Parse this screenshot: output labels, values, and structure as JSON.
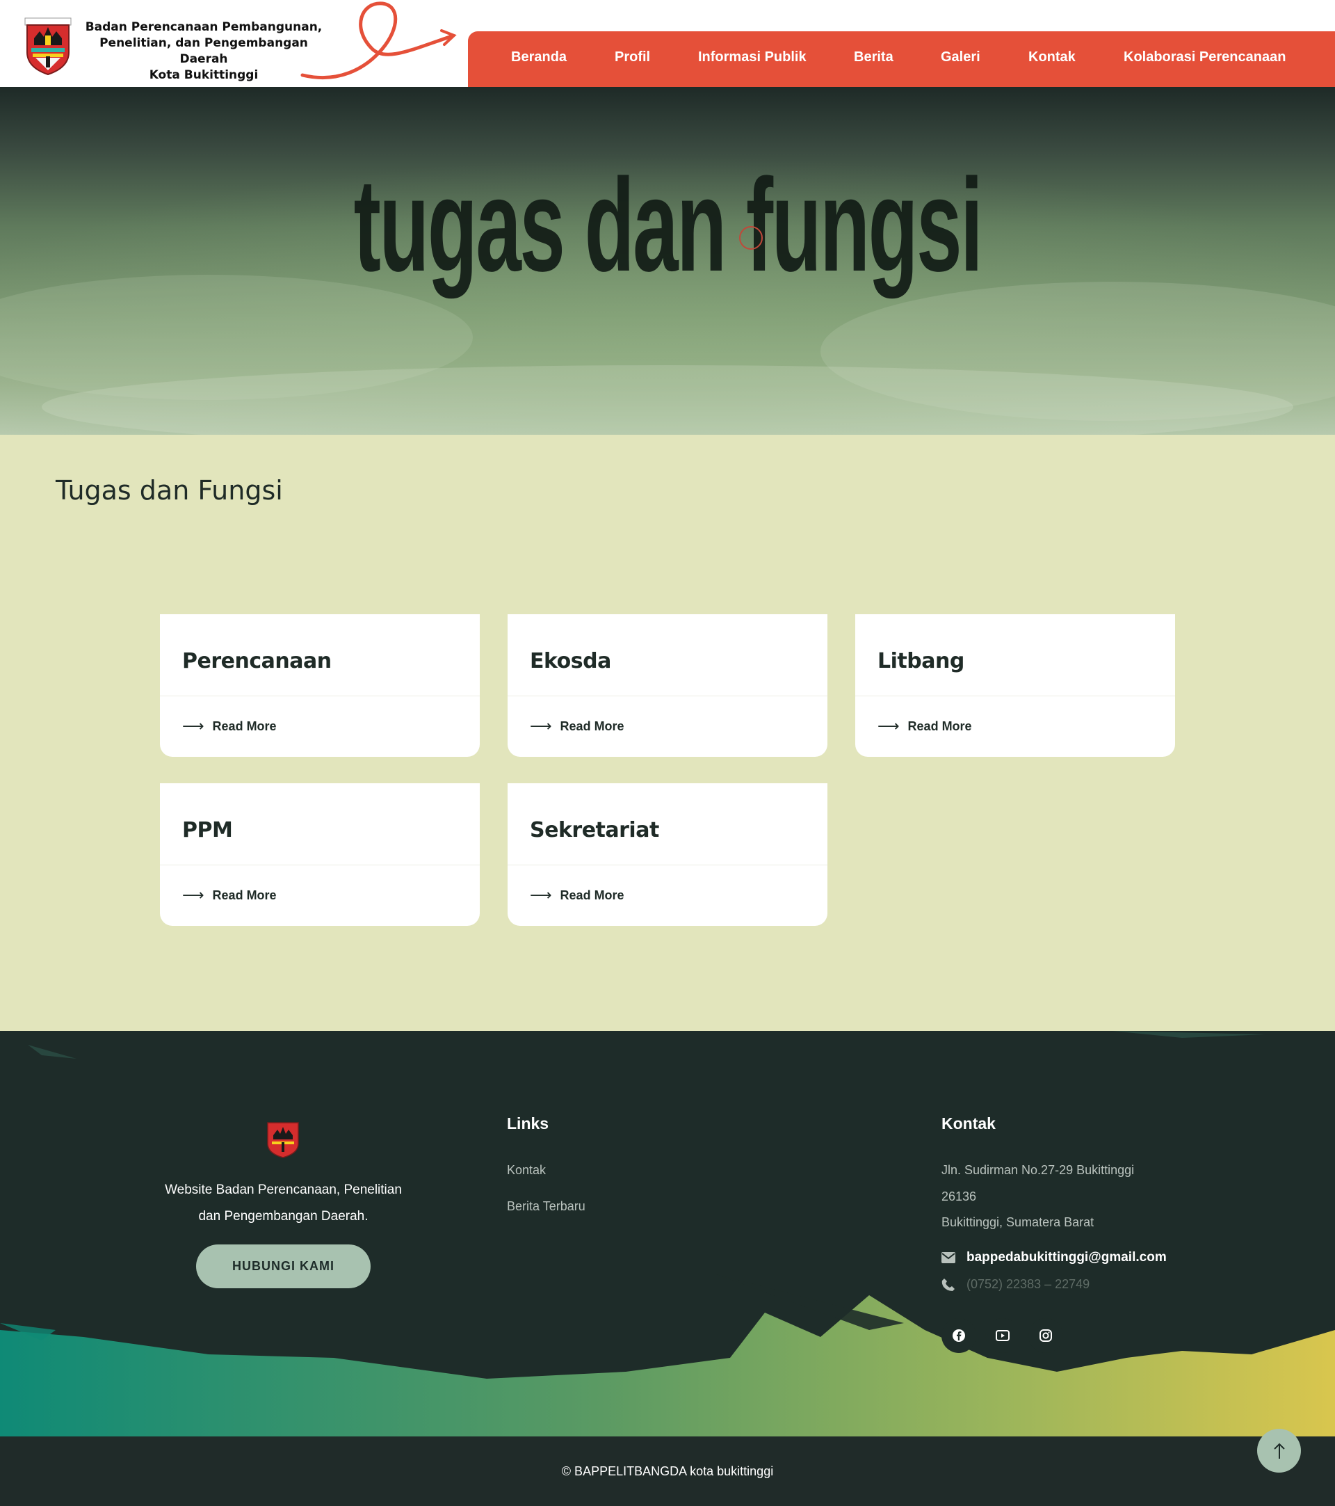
{
  "header": {
    "org_name_line1": "Badan Perencanaan Pembangunan,",
    "org_name_line2": "Penelitian, dan Pengembangan Daerah",
    "org_name_line3": "Kota Bukittinggi",
    "logo_label": "BUKITTINGGI",
    "nav": [
      "Beranda",
      "Profil",
      "Informasi Publik",
      "Berita",
      "Galeri",
      "Kontak",
      "Kolaborasi Perencanaan"
    ]
  },
  "hero": {
    "title": "tugas dan fungsi"
  },
  "main": {
    "title": "Tugas dan Fungsi",
    "cards": [
      {
        "title": "Perencanaan",
        "link": "Read More"
      },
      {
        "title": "Ekosda",
        "link": "Read More"
      },
      {
        "title": "Litbang",
        "link": "Read More"
      },
      {
        "title": "PPM",
        "link": "Read More"
      },
      {
        "title": "Sekretariat",
        "link": "Read More"
      }
    ]
  },
  "footer": {
    "description_line1": "Website Badan Perencanaan, Penelitian",
    "description_line2": "dan Pengembangan Daerah.",
    "button": "HUBUNGI KAMI",
    "links_heading": "Links",
    "links": [
      "Kontak",
      "Berita Terbaru"
    ],
    "contact_heading": "Kontak",
    "address_line1": "Jln. Sudirman No.27-29 Bukittinggi",
    "address_line2": "26136",
    "address_line3": "Bukittinggi, Sumatera Barat",
    "email": "bappedabukittinggi@gmail.com",
    "phone": "(0752) 22383 – 22749",
    "social_icons": [
      "facebook-icon",
      "youtube-icon",
      "instagram-icon"
    ],
    "copyright": "© BAPPELITBANGDA kota bukittinggi"
  },
  "colors": {
    "nav_bg": "#e55039",
    "main_bg": "#e2e5bc",
    "footer_bg": "#1e2c29",
    "button_bg": "#a8c2b0"
  }
}
